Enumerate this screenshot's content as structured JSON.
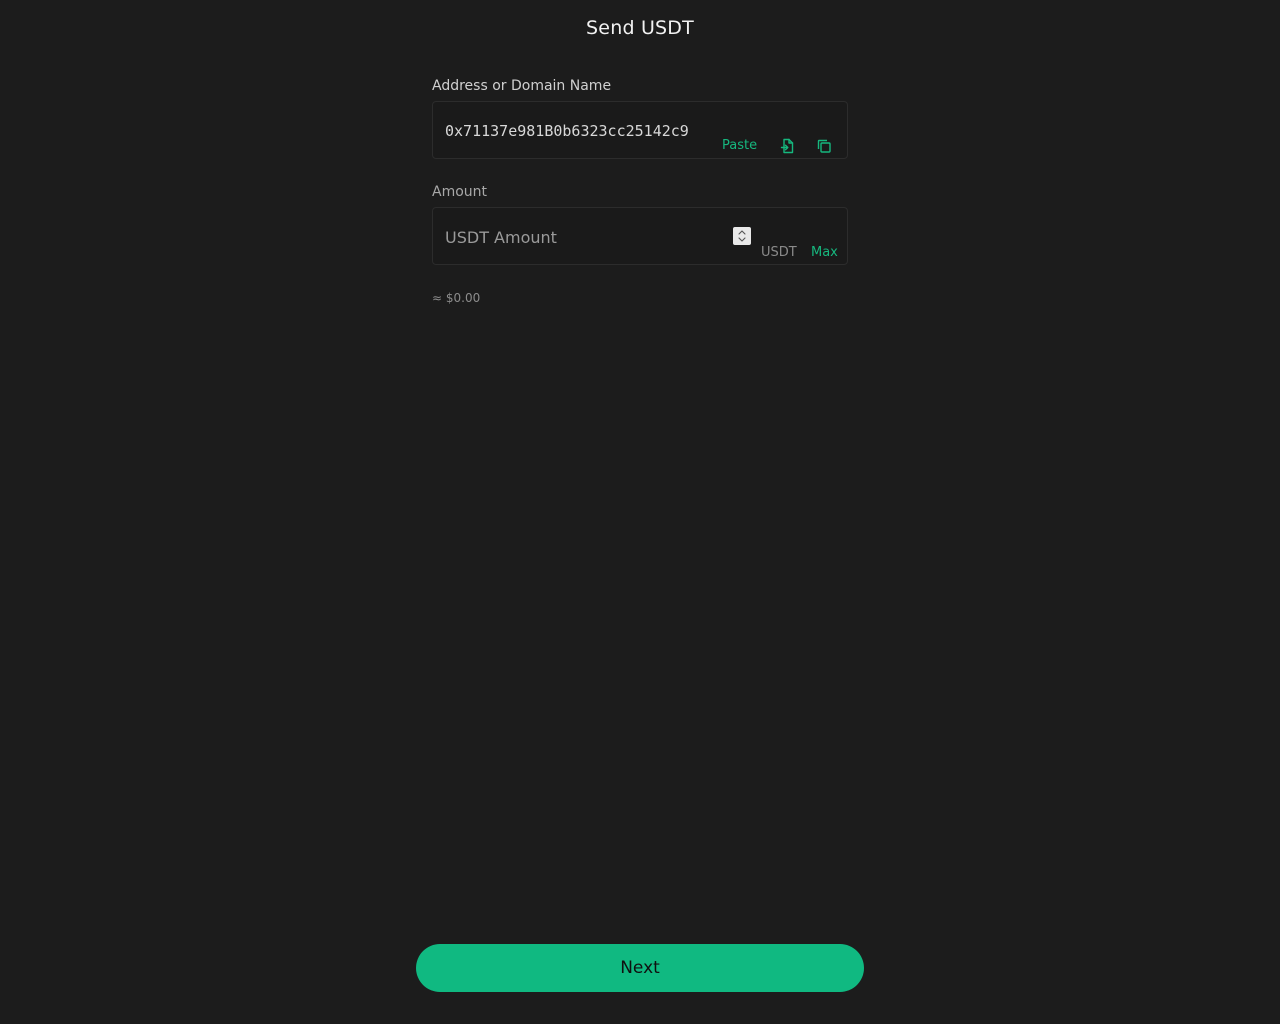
{
  "header": {
    "title": "Send USDT"
  },
  "address": {
    "label": "Address or Domain Name",
    "value": "0x71137e981B0b6323cc25142c9",
    "paste_label": "Paste",
    "icons": [
      "paste-file-icon",
      "copy-icon"
    ]
  },
  "amount": {
    "label": "Amount",
    "placeholder": "USDT Amount",
    "value": "",
    "unit": "USDT",
    "max_label": "Max",
    "fiat_estimate": "≈ $0.00"
  },
  "footer": {
    "next_label": "Next"
  },
  "colors": {
    "background": "#1c1c1c",
    "accent": "#10b981",
    "accent_text": "#16b77e"
  }
}
